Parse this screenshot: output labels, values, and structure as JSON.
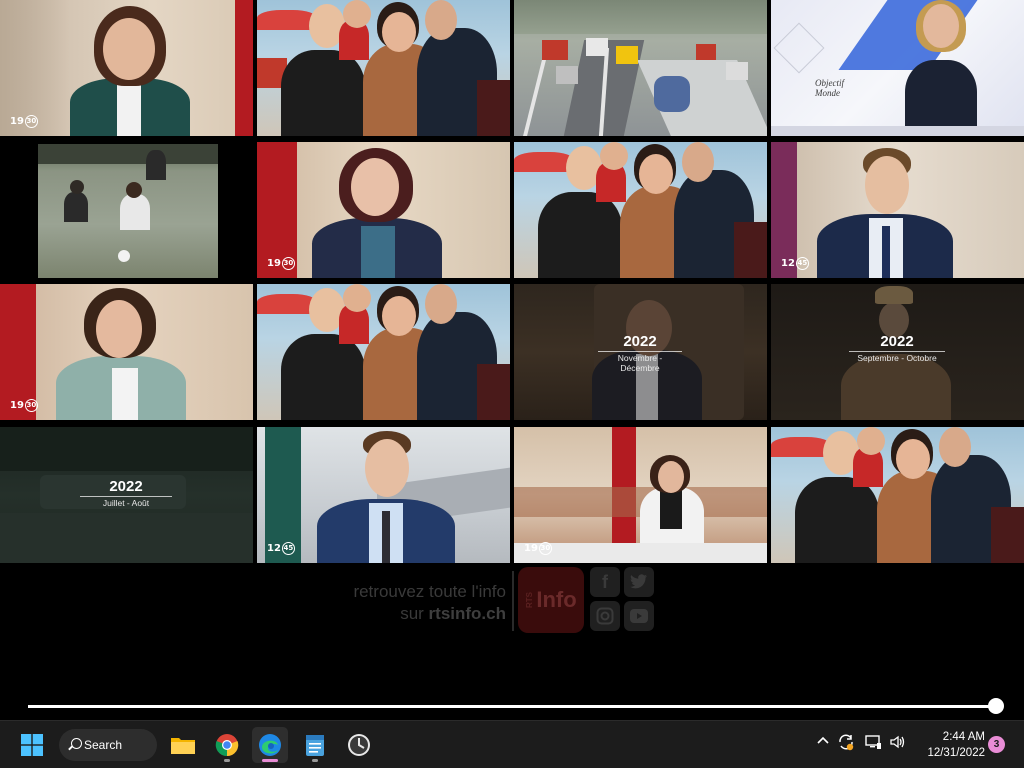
{
  "video": {
    "tiles": [
      {
        "id": 1,
        "kind": "anchor",
        "badge": "19",
        "badge_ring": "30"
      },
      {
        "id": 2,
        "kind": "group-outdoor"
      },
      {
        "id": 3,
        "kind": "traffic-scene"
      },
      {
        "id": 4,
        "kind": "studio-objectif-monde",
        "overlay_text": "Objectif Monde"
      },
      {
        "id": 5,
        "kind": "archive-football"
      },
      {
        "id": 6,
        "kind": "anchor",
        "badge": "19",
        "badge_ring": "30"
      },
      {
        "id": 7,
        "kind": "group-outdoor"
      },
      {
        "id": 8,
        "kind": "anchor-male",
        "badge": "12",
        "badge_ring": "45"
      },
      {
        "id": 9,
        "kind": "anchor",
        "badge": "19",
        "badge_ring": "30"
      },
      {
        "id": 10,
        "kind": "group-outdoor"
      },
      {
        "id": 11,
        "kind": "year-card",
        "year": "2022",
        "months": "Novembre - Décembre"
      },
      {
        "id": 12,
        "kind": "year-card",
        "year": "2022",
        "months": "Septembre - Octobre"
      },
      {
        "id": 13,
        "kind": "year-card",
        "year": "2022",
        "months": "Juillet - Août"
      },
      {
        "id": 14,
        "kind": "anchor-male",
        "badge": "12",
        "badge_ring": "45"
      },
      {
        "id": 15,
        "kind": "anchor-desk",
        "badge": "19",
        "badge_ring": "30"
      },
      {
        "id": 16,
        "kind": "group-outdoor"
      }
    ],
    "promo": {
      "line1": "retrouvez toute l'info",
      "line2_prefix": "sur ",
      "line2_site": "rtsinfo.ch",
      "logo_small": "RTS",
      "logo_text": "Info",
      "social_icons": [
        "facebook-icon",
        "twitter-icon",
        "instagram-icon",
        "youtube-icon"
      ]
    },
    "progress_fraction": 1.0
  },
  "taskbar": {
    "search_label": "Search",
    "apps": [
      "start-icon",
      "file-explorer-icon",
      "chrome-icon",
      "edge-icon",
      "notepad-icon",
      "clock-app-icon"
    ],
    "clock": {
      "time": "2:44 AM",
      "date": "12/31/2022"
    },
    "notification_count": "3"
  },
  "colors": {
    "accent": "#e98dd6",
    "rts_red": "#c1121f"
  }
}
